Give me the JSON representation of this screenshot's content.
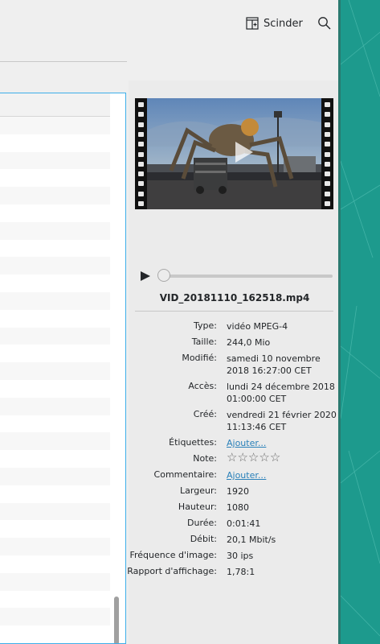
{
  "toolbar": {
    "split_label": "Scinder",
    "split_icon": "split-view-icon",
    "search_icon": "search-icon"
  },
  "info": {
    "file_name": "VID_20181110_162518.mp4",
    "properties": [
      {
        "key": "Type:",
        "value": "vidéo MPEG-4",
        "lines": 1
      },
      {
        "key": "Taille:",
        "value": "244,0 Mio",
        "lines": 1
      },
      {
        "key": "Modifié:",
        "value": "samedi 10 novembre 2018 16:27:00 CET",
        "lines": 2
      },
      {
        "key": "Accès:",
        "value": "lundi 24 décembre 2018 01:00:00 CET",
        "lines": 2
      },
      {
        "key": "Créé:",
        "value": "vendredi 21 février 2020 11:13:46 CET",
        "lines": 2
      },
      {
        "key": "Étiquettes:",
        "value": "Ajouter...",
        "link": true,
        "lines": 1
      },
      {
        "key": "Note:",
        "rating": 0,
        "rating_max": 5,
        "lines": 1
      },
      {
        "key": "Commentaire:",
        "value": "Ajouter...",
        "link": true,
        "lines": 1
      },
      {
        "key": "Largeur:",
        "value": "1920",
        "lines": 1
      },
      {
        "key": "Hauteur:",
        "value": "1080",
        "lines": 1
      },
      {
        "key": "Durée:",
        "value": "0:01:41",
        "lines": 1
      },
      {
        "key": "Débit:",
        "value": "20,1 Mbit/s",
        "lines": 1
      },
      {
        "key": "Fréquence d'image:",
        "value": "30 ips",
        "lines": 1
      },
      {
        "key": "Rapport d'affichage:",
        "value": "1,78:1",
        "lines": 1
      }
    ],
    "player_progress": 0
  },
  "colors": {
    "accent": "#3daee9",
    "link": "#2980b9",
    "desktop": "#1d9a8d"
  }
}
